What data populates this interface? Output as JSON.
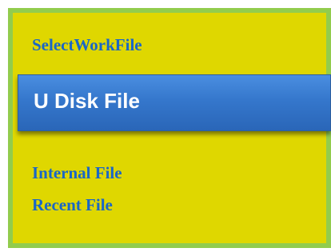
{
  "panel": {
    "title": "SelectWorkFile",
    "selected_item": "U Disk File",
    "items": [
      "Internal File",
      "Recent File"
    ]
  },
  "colors": {
    "panel_background": "#dfd700",
    "panel_border": "#92cc4d",
    "text": "#1a66c7",
    "selected_background": "#3577cc",
    "selected_text": "#ffffff"
  }
}
